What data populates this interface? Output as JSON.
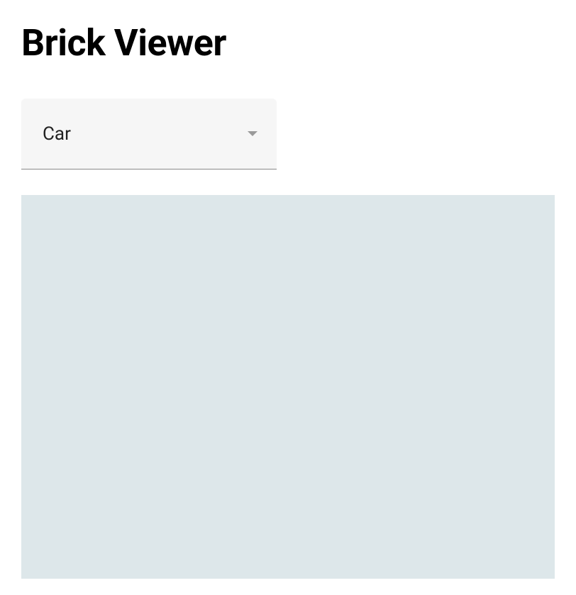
{
  "header": {
    "title": "Brick Viewer"
  },
  "selector": {
    "selected_value": "Car"
  }
}
